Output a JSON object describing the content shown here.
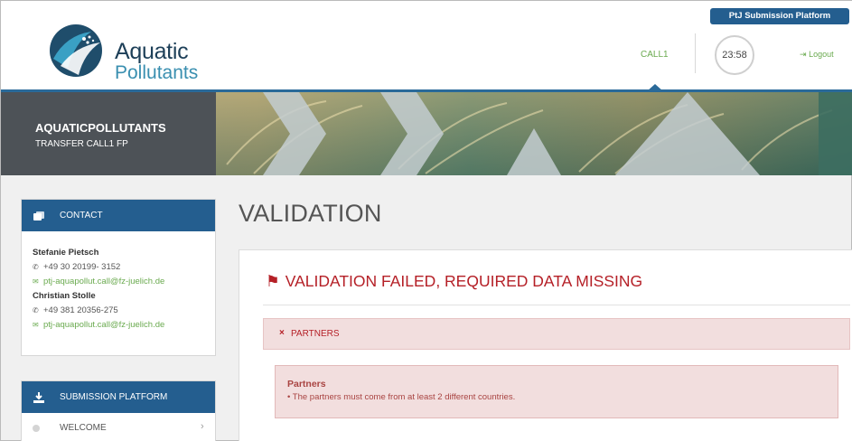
{
  "header": {
    "logo_line1": "Aquatic",
    "logo_line2": "Pollutants",
    "platform_tab": "PtJ Submission Platform",
    "nav_item": "CALL1",
    "timer": "23:58",
    "logout": "Logout"
  },
  "banner": {
    "title": "AQUATICPOLLUTANTS",
    "subtitle": "TRANSFER CALL1 FP"
  },
  "sidebar": {
    "contact": {
      "heading": "CONTACT",
      "people": [
        {
          "name": "Stefanie Pietsch",
          "phone": "+49 30 20199- 3152",
          "email": "ptj-aquapollut.call@fz-juelich.de"
        },
        {
          "name": "Christian Stolle",
          "phone": "+49 381 20356-275",
          "email": "ptj-aquapollut.call@fz-juelich.de"
        }
      ]
    },
    "submission": {
      "heading": "SUBMISSION PLATFORM",
      "items": [
        {
          "label": "WELCOME"
        }
      ]
    }
  },
  "main": {
    "page_title": "VALIDATION",
    "status": "VALIDATION FAILED, REQUIRED DATA MISSING",
    "section": "PARTNERS",
    "alert_title": "Partners",
    "alert_message": "The partners must come from at least 2 different countries."
  },
  "colors": {
    "brand_blue": "#245e8f",
    "accent_green": "#6aaa4f",
    "error_red": "#b52027",
    "error_bg": "#f2dede"
  }
}
